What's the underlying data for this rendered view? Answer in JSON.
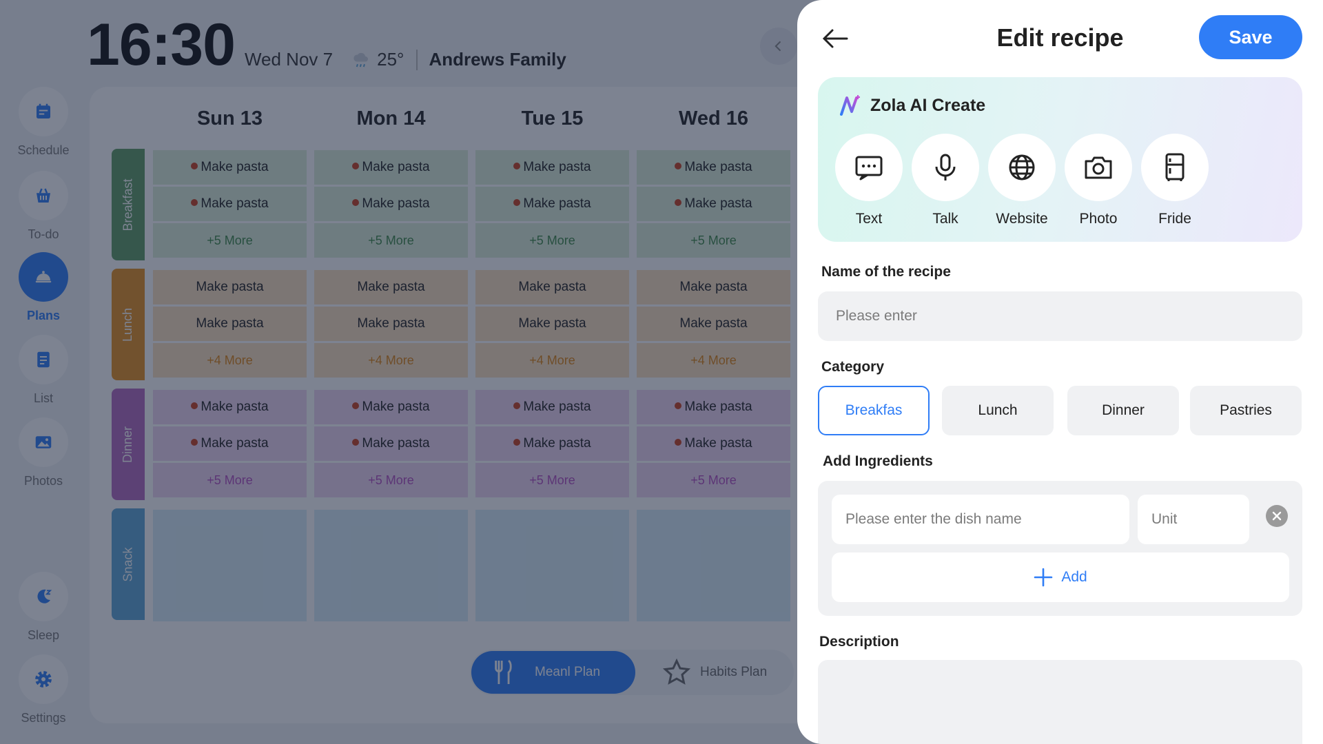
{
  "sidebar": {
    "items": [
      {
        "label": "Schedule",
        "icon": "calendar-icon"
      },
      {
        "label": "To-do",
        "icon": "basket-icon"
      },
      {
        "label": "Plans",
        "icon": "cloche-icon",
        "active": true
      },
      {
        "label": "List",
        "icon": "list-icon"
      },
      {
        "label": "Photos",
        "icon": "image-icon"
      },
      {
        "label": "Sleep",
        "icon": "moon-icon"
      },
      {
        "label": "Settings",
        "icon": "gear-icon"
      }
    ]
  },
  "header": {
    "time": "16:30",
    "date": "Wed Nov 7",
    "temperature": "25°",
    "weather_icon": "rain-cloud-icon",
    "family": "Andrews Family"
  },
  "calendar": {
    "days": [
      "Sun 13",
      "Mon 14",
      "Tue 15",
      "Wed 16"
    ],
    "meals": [
      {
        "name": "Breakfast",
        "color": "#5e9b63",
        "cell_color": "#dcefd9",
        "more_color": "#3f8a47",
        "items": [
          "Make pasta",
          "Make pasta"
        ],
        "more": "+5 More"
      },
      {
        "name": "Lunch",
        "color": "#e58f1f",
        "cell_color": "#fde2bd",
        "more_color": "#e08512",
        "items": [
          "Make pasta",
          "Make pasta"
        ],
        "more": "+4 More"
      },
      {
        "name": "Dinner",
        "color": "#b56abf",
        "cell_color": "#f0d5f2",
        "more_color": "#b34ec0",
        "items": [
          "Make pasta",
          "Make pasta"
        ],
        "more": "+5 More"
      },
      {
        "name": "Snack",
        "color": "#5ea6d6",
        "cell_color": "#d8ecf7"
      }
    ]
  },
  "plan_toggle": {
    "meal_plan": "Meanl Plan",
    "habits_plan": "Habits Plan"
  },
  "modal": {
    "title": "Edit recipe",
    "save": "Save",
    "ai": {
      "title": "Zola AI Create",
      "options": [
        {
          "label": "Text",
          "icon": "chat-icon"
        },
        {
          "label": "Talk",
          "icon": "microphone-icon"
        },
        {
          "label": "Website",
          "icon": "globe-icon"
        },
        {
          "label": "Photo",
          "icon": "camera-icon"
        },
        {
          "label": "Fride",
          "icon": "fridge-icon"
        }
      ]
    },
    "name_label": "Name of the recipe",
    "name_placeholder": "Please enter",
    "name_value": "",
    "category_label": "Category",
    "categories": [
      "Breakfas",
      "Lunch",
      "Dinner",
      "Pastries"
    ],
    "selected_category": "Breakfas",
    "ingredients_label": "Add Ingredients",
    "dish_placeholder": "Please enter the dish name",
    "unit_placeholder": "Unit",
    "add_label": "Add",
    "description_label": "Description",
    "description_value": ""
  },
  "colors": {
    "accent": "#2f7df6",
    "overlay": "rgba(24,34,58,0.56)"
  }
}
